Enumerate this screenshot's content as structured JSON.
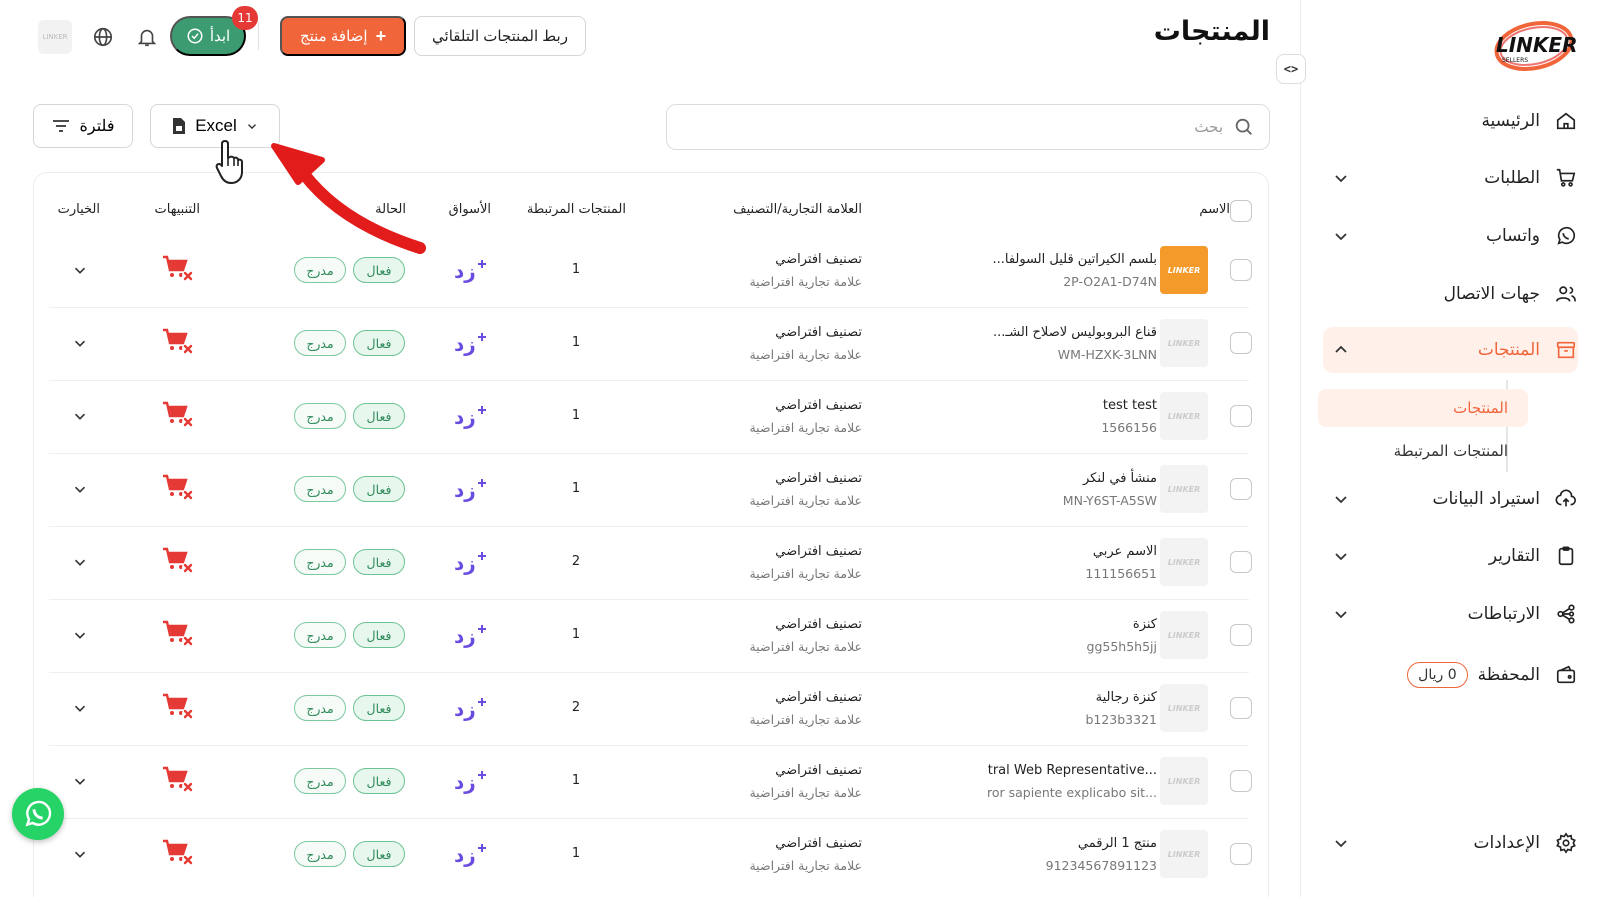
{
  "header": {
    "title": "المنتجات",
    "auto_link_label": "ربط المنتجات التلقائي",
    "add_product_label": "إضافة منتج",
    "start_label": "ابدأ",
    "start_badge": "11",
    "avatar_text": "LINKER"
  },
  "toolbar": {
    "search_placeholder": "بحث",
    "excel_label": "Excel",
    "filter_label": "فلترة"
  },
  "sidebar": {
    "logo_text": "LINKER",
    "logo_sub": "SELLERS",
    "items": [
      {
        "label": "الرئيسية",
        "icon": "home-icon"
      },
      {
        "label": "الطلبات",
        "icon": "cart-icon"
      },
      {
        "label": "واتساب",
        "icon": "whatsapp-icon"
      },
      {
        "label": "جهات الاتصال",
        "icon": "contacts-icon"
      },
      {
        "label": "المنتجات",
        "icon": "box-icon"
      },
      {
        "label": "استيراد البيانات",
        "icon": "upload-cloud-icon"
      },
      {
        "label": "التقارير",
        "icon": "clipboard-icon"
      },
      {
        "label": "الارتباطات",
        "icon": "share-nodes-icon"
      },
      {
        "label": "المحفظة",
        "icon": "wallet-icon"
      },
      {
        "label": "الإعدادات",
        "icon": "gear-icon"
      }
    ],
    "sub_items": [
      "المنتجات",
      "المنتجات المرتبطة"
    ],
    "wallet_balance": "0 ريال"
  },
  "table": {
    "headers": {
      "name": "الاسم",
      "brand": "العلامة التجارية/التصنيف",
      "linked": "المنتجات المرتبطة",
      "markets": "الأسواق",
      "status": "الحالة",
      "alerts": "التنبيهات",
      "options": "الخيارت"
    },
    "rows": [
      {
        "name": "بلسم الكيراتين قليل السولفا...",
        "sku": "2P-O2A1-D74N",
        "category": "تصنيف افتراضي",
        "brand": "علامة تجارية افتراضية",
        "linked": "1",
        "market": "زد",
        "status": "فعال",
        "listed": "مدرج"
      },
      {
        "name": "قناع البروبوليس لاصلاح الشـ...",
        "sku": "WM-HZXK-3LNN",
        "category": "تصنيف افتراضي",
        "brand": "علامة تجارية افتراضية",
        "linked": "1",
        "market": "زد",
        "status": "فعال",
        "listed": "مدرج"
      },
      {
        "name": "test test",
        "sku": "1566156",
        "category": "تصنيف افتراضي",
        "brand": "علامة تجارية افتراضية",
        "linked": "1",
        "market": "زد",
        "status": "فعال",
        "listed": "مدرج"
      },
      {
        "name": "منشأ في لنكر",
        "sku": "MN-Y6ST-A5SW",
        "category": "تصنيف افتراضي",
        "brand": "علامة تجارية افتراضية",
        "linked": "1",
        "market": "زد",
        "status": "فعال",
        "listed": "مدرج"
      },
      {
        "name": "الاسم عربي",
        "sku": "111156651",
        "category": "تصنيف افتراضي",
        "brand": "علامة تجارية افتراضية",
        "linked": "2",
        "market": "زد",
        "status": "فعال",
        "listed": "مدرج"
      },
      {
        "name": "كنزة",
        "sku": "gg55h5h5jj",
        "category": "تصنيف افتراضي",
        "brand": "علامة تجارية افتراضية",
        "linked": "1",
        "market": "زد",
        "status": "فعال",
        "listed": "مدرج"
      },
      {
        "name": "كنزة رجالية",
        "sku": "b123b3321",
        "category": "تصنيف افتراضي",
        "brand": "علامة تجارية افتراضية",
        "linked": "2",
        "market": "زد",
        "status": "فعال",
        "listed": "مدرج"
      },
      {
        "name": "...tral Web Representative",
        "sku": "...ror sapiente explicabo sit",
        "category": "تصنيف افتراضي",
        "brand": "علامة تجارية افتراضية",
        "linked": "1",
        "market": "زد",
        "status": "فعال",
        "listed": "مدرج"
      },
      {
        "name": "منتج 1 الرقمي",
        "sku": "91234567891123",
        "category": "تصنيف افتراضي",
        "brand": "علامة تجارية افتراضية",
        "linked": "1",
        "market": "زد",
        "status": "فعال",
        "listed": "مدرج"
      }
    ]
  },
  "colors": {
    "accent": "#f0653a",
    "start_green": "#3d9b72",
    "badge_red": "#e53935",
    "market_purple": "#6a4ce0",
    "annotation_red": "#e21b1b"
  }
}
